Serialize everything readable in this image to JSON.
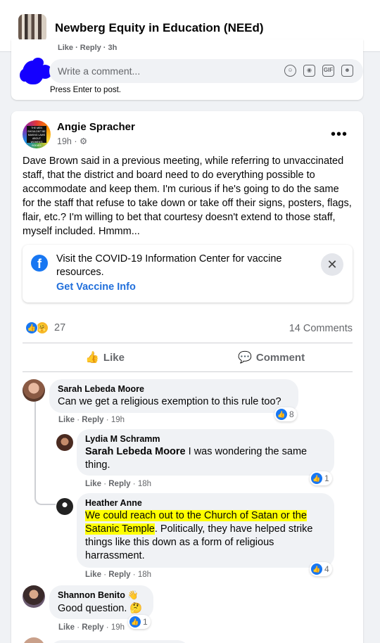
{
  "group": {
    "name": "Newberg Equity in Education (NEEd)"
  },
  "prev_comment": {
    "meta": "Like · Reply · 3h"
  },
  "composer": {
    "placeholder": "Write a comment...",
    "hint": "Press Enter to post.",
    "icons": [
      "emoji-icon",
      "camera-icon",
      "gif-icon",
      "sticker-icon"
    ],
    "gif_label": "GIF"
  },
  "post": {
    "author": "Angie Spracher",
    "time": "19h",
    "privacy_icon": "group-privacy-icon",
    "avatar_text": "THE MEN SHOULDN'T BE MAKING LAWS ABOUT WOMEN'S BODIES",
    "body": "Dave Brown said in a previous meeting, while referring to unvaccinated staff, that the district and board need to do everything possible to accommodate and keep them. I'm curious if he's going to do the same for the staff that refuse to take down or take off their signs, posters, flags, flair, etc.? I'm willing to bet that courtesy doesn't extend to those staff, myself included. Hmmm...",
    "covid": {
      "text": "Visit the COVID-19 Information Center for vaccine resources.",
      "link": "Get Vaccine Info",
      "close": "✕"
    },
    "reactions": {
      "count": "27",
      "types": [
        "like",
        "care"
      ]
    },
    "comments_count": "14 Comments",
    "actions": {
      "like": "Like",
      "comment": "Comment"
    }
  },
  "comments": [
    {
      "name": "Sarah Lebeda Moore",
      "text": "Can we get a religious exemption to this rule too?",
      "like": "Like",
      "reply": "Reply",
      "time": "19h",
      "reactions": "8"
    },
    {
      "name": "Lydia M Schramm",
      "mention": "Sarah Lebeda Moore",
      "text": " I was wondering the same thing.",
      "like": "Like",
      "reply": "Reply",
      "time": "18h",
      "reactions": "1"
    },
    {
      "name": "Heather Anne",
      "text_highlight_1": "We could reach out to the Church of Satan or the",
      "text_highlight_2": "Satanic Temple",
      "text_rest": ". Politically, they have helped strike things like this down as a form of religious harrassment.",
      "like": "Like",
      "reply": "Reply",
      "time": "18h",
      "reactions": "4"
    },
    {
      "name": "Shannon Benito",
      "badge_icon": "wave-hand-icon",
      "text": "Good question.",
      "emoji": "thinking-face-icon",
      "like": "Like",
      "reply": "Reply",
      "time": "19h",
      "reactions": "1"
    }
  ],
  "colors": {
    "accent": "#1877f2",
    "link": "#216fdb",
    "highlight": "#ffff00",
    "blob": "#1400ff"
  }
}
